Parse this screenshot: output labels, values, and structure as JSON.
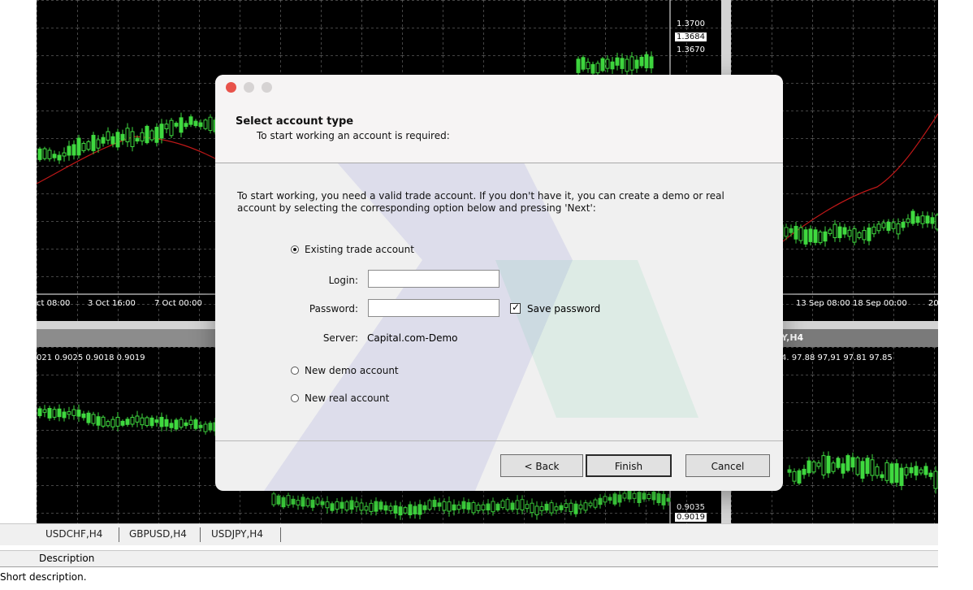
{
  "charts": {
    "top_left": {
      "time_labels": [
        "ct 08:00",
        "3 Oct 16:00",
        "7 Oct 00:00"
      ]
    },
    "top_middle": {
      "price_labels": [
        "1.3700",
        "1.3684",
        "1.3670"
      ]
    },
    "top_right": {
      "time_labels": [
        "13 Sep 08:00",
        "18 Sep 00:00",
        "20"
      ]
    },
    "bottom_left": {
      "ohlc_readout": "021 0.9025 0.9018 0.9019"
    },
    "bottom_middle": {
      "price_labels": [
        "0.9035",
        "0.9019"
      ]
    },
    "bottom_right": {
      "title": "Y,H4",
      "ohlc_readout": "4. 97.88 97,91 97.81 97.85"
    }
  },
  "tabs": [
    "USDCHF,H4",
    "GBPUSD,H4",
    "USDJPY,H4"
  ],
  "description": {
    "header": "Description",
    "body": "Short description."
  },
  "dialog": {
    "title": "Select account type",
    "subtitle": "To start working an account is required:",
    "intro": "To start working, you need a valid trade account. If you don't have it, you can create a demo or real account by selecting the corresponding option below and pressing 'Next':",
    "options": {
      "existing": "Existing trade account",
      "demo": "New demo account",
      "real": "New real account"
    },
    "login_label": "Login:",
    "login_value": "",
    "password_label": "Password:",
    "password_value": "",
    "save_password_label": "Save password",
    "save_password_checked": true,
    "server_label": "Server:",
    "server_value": "Capital.com-Demo",
    "buttons": {
      "back": "< Back",
      "finish": "Finish",
      "cancel": "Cancel"
    }
  },
  "colors": {
    "chart_bg": "#000000",
    "candle": "#3fd93f",
    "ma_line": "#c01818",
    "grid": "#8a8a8a",
    "close_red": "#e8524a",
    "traffic_grey": "#d6d3d3"
  }
}
